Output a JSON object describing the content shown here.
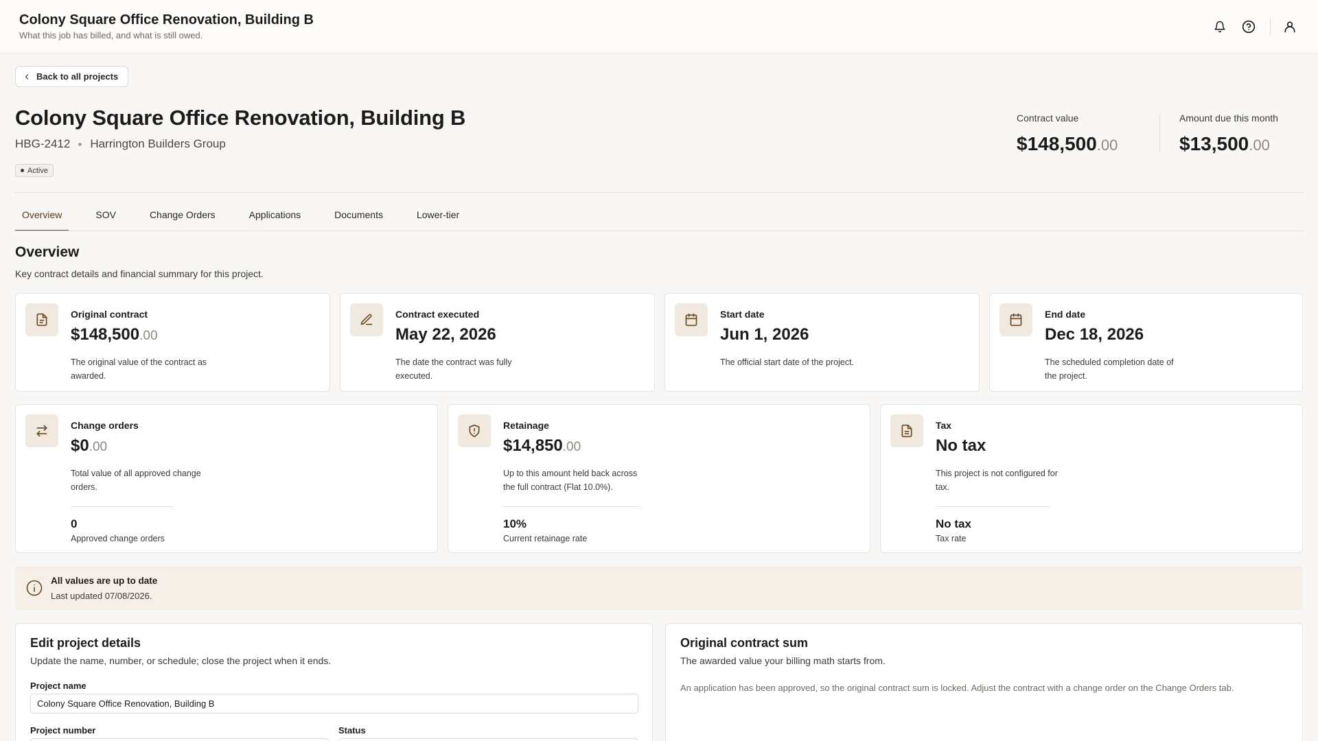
{
  "topbar": {
    "title": "Colony Square Office Renovation, Building B",
    "subtitle": "What this job has billed, and what is still owed.",
    "icons": [
      "bell-icon",
      "help-icon",
      "user-icon"
    ]
  },
  "back_button": {
    "label": "Back to all projects",
    "icon": "chevron-left-icon"
  },
  "project": {
    "title": "Colony Square Office Renovation, Building B",
    "number": "HBG-2412",
    "company": "Harrington Builders Group",
    "status": "Active"
  },
  "kpis": {
    "contract_value": {
      "label": "Contract value",
      "whole": "$148,500",
      "cents": ".00"
    },
    "amount_due": {
      "label": "Amount due this month",
      "whole": "$13,500",
      "cents": ".00"
    }
  },
  "tabs": [
    "Overview",
    "SOV",
    "Change Orders",
    "Applications",
    "Documents",
    "Lower-tier"
  ],
  "active_tab": "Overview",
  "overview": {
    "title": "Overview",
    "description": "Key contract details and financial summary for this project."
  },
  "cards_row1": [
    {
      "label": "Original contract",
      "whole": "$148,500",
      "cents": ".00",
      "desc": "The original value of the contract as awarded.",
      "icon": "document-icon"
    },
    {
      "label": "Contract executed",
      "whole": "May 22, 2026",
      "cents": "",
      "desc": "The date the contract was fully executed.",
      "icon": "pencil-icon"
    },
    {
      "label": "Start date",
      "whole": "Jun 1, 2026",
      "cents": "",
      "desc": "The official start date of the project.",
      "icon": "calendar-icon"
    },
    {
      "label": "End date",
      "whole": "Dec 18, 2026",
      "cents": "",
      "desc": "The scheduled completion date of the project.",
      "icon": "calendar-icon"
    }
  ],
  "cards_row2": [
    {
      "label": "Change orders",
      "whole": "$0",
      "cents": ".00",
      "desc": "Total value of all approved change orders.",
      "sub_value": "0",
      "sub_label": "Approved change orders",
      "icon": "swap-arrows-icon"
    },
    {
      "label": "Retainage",
      "whole": "$14,850",
      "cents": ".00",
      "desc": "Up to this amount held back across the full contract (Flat 10.0%).",
      "sub_value": "10%",
      "sub_label": "Current retainage rate",
      "icon": "shield-icon"
    },
    {
      "label": "Tax",
      "whole": "No tax",
      "cents": "",
      "desc": "This project is not configured for tax.",
      "sub_value": "No tax",
      "sub_label": "Tax rate",
      "icon": "receipt-icon"
    }
  ],
  "notice": {
    "title": "All values are up to date",
    "text": "Last updated 07/08/2026."
  },
  "edit_panel": {
    "title": "Edit project details",
    "subtitle": "Update the name, number, or schedule; close the project when it ends.",
    "name_label": "Project name",
    "name_value": "Colony Square Office Renovation, Building B",
    "number_label": "Project number",
    "status_label": "Status"
  },
  "contract_panel": {
    "title": "Original contract sum",
    "subtitle": "The awarded value your billing math starts from.",
    "note": "An application has been approved, so the original contract sum is locked. Adjust the contract with a change order on the Change Orders tab."
  },
  "colors": {
    "accent": "#7a4e1f",
    "icon_bg": "#efe9e0",
    "notice_bg": "#f6efe8"
  }
}
